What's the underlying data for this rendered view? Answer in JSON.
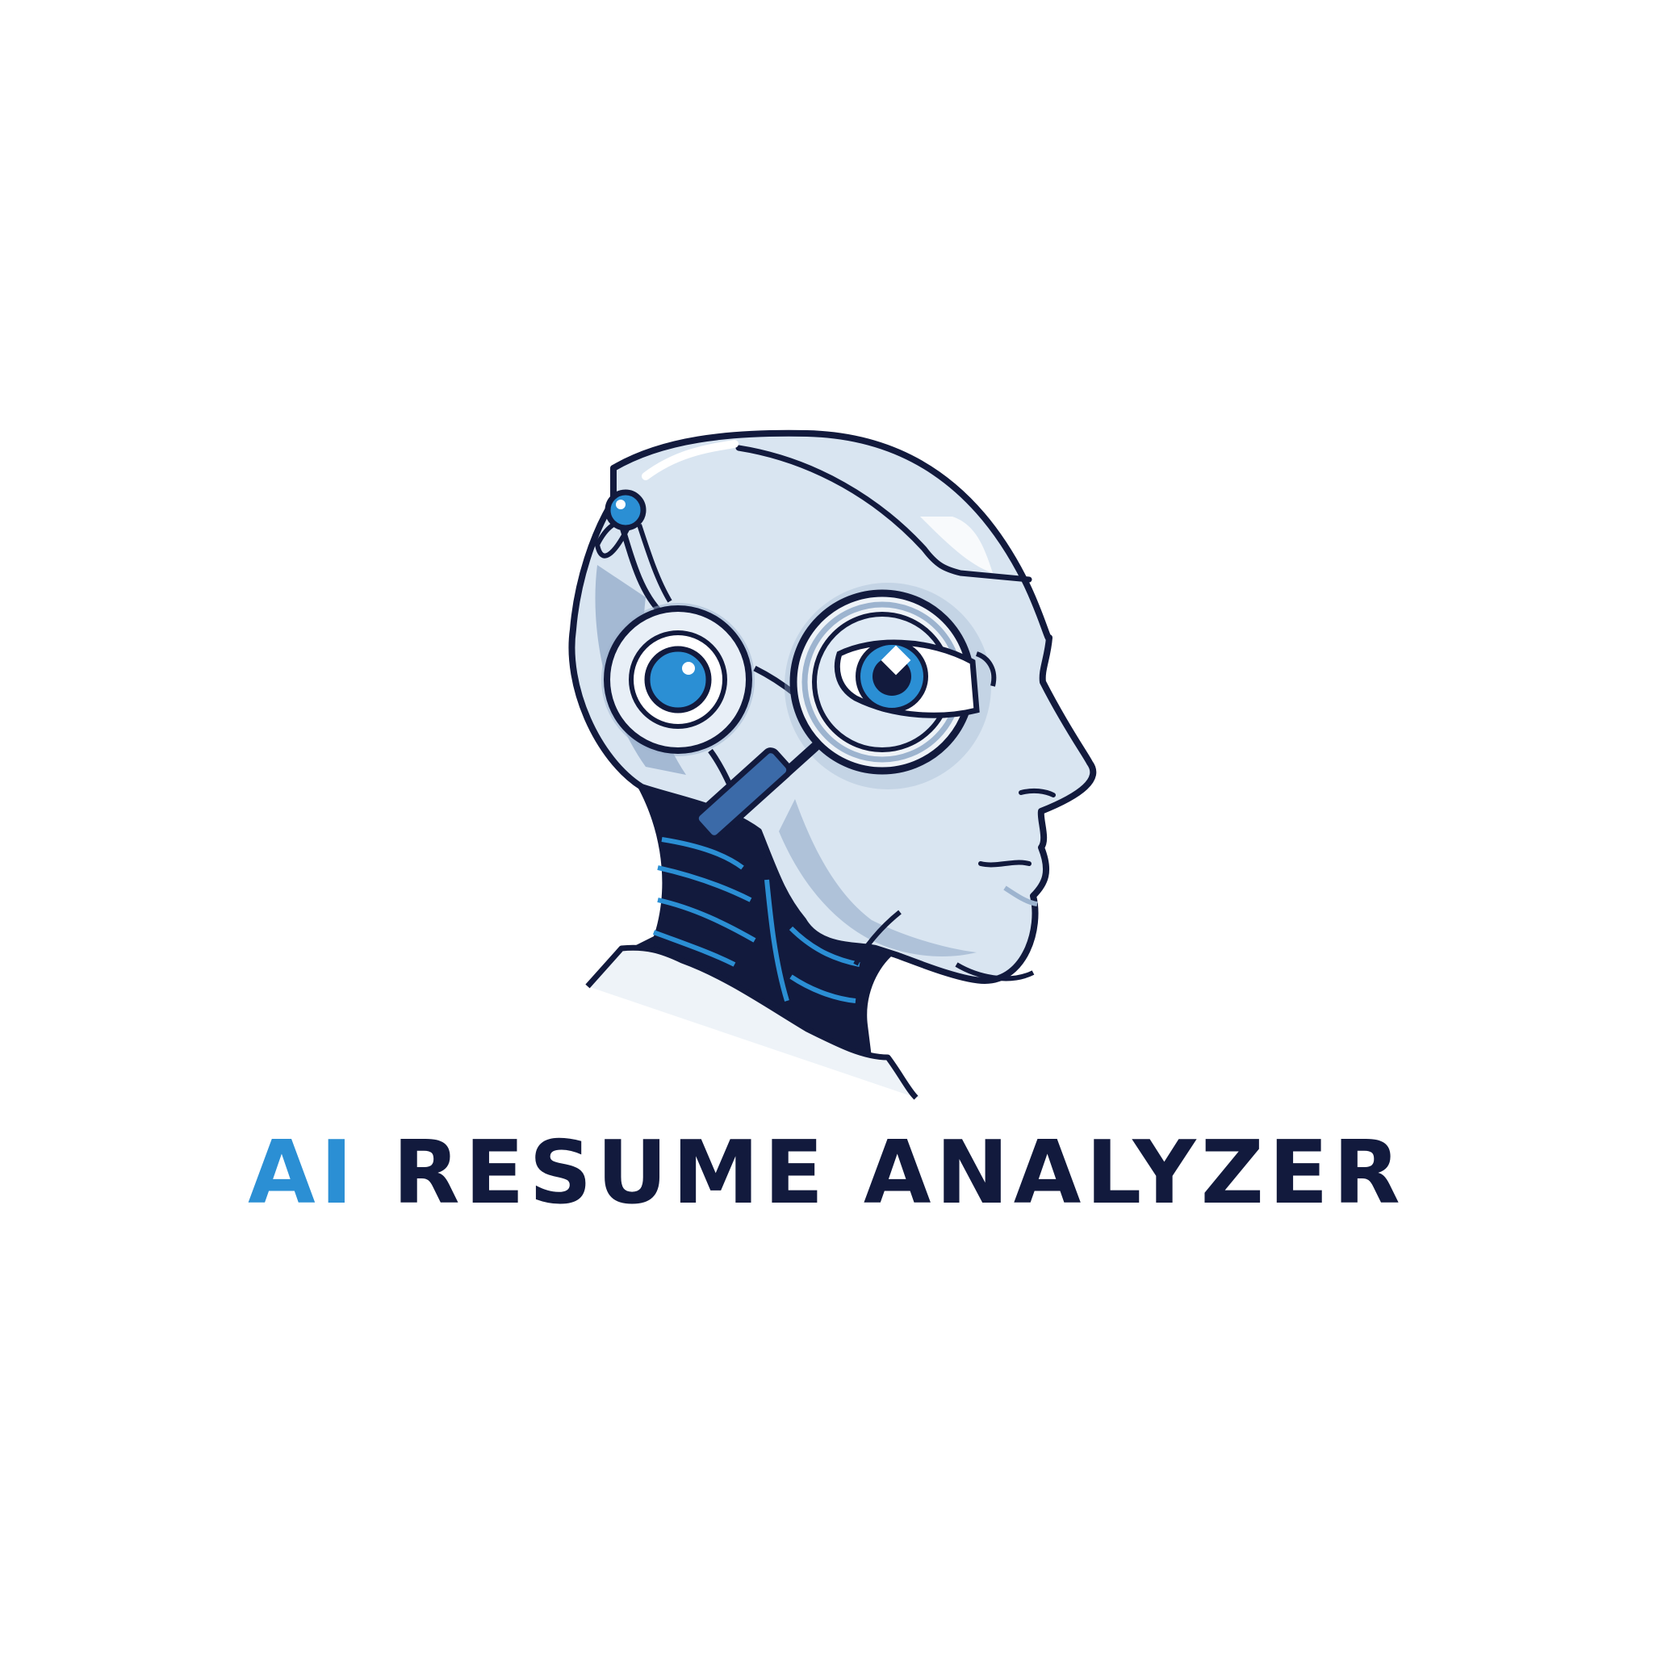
{
  "logo": {
    "wordmark_accent": "AI",
    "wordmark_main": "RESUME ANALYZER",
    "colors": {
      "accent": "#2b8fd4",
      "ink": "#121a3d",
      "head_fill": "#d9e5f1",
      "shadow_fill": "#9db4cf",
      "background": "#ffffff"
    },
    "icon": "robot-head-magnifier-icon"
  }
}
